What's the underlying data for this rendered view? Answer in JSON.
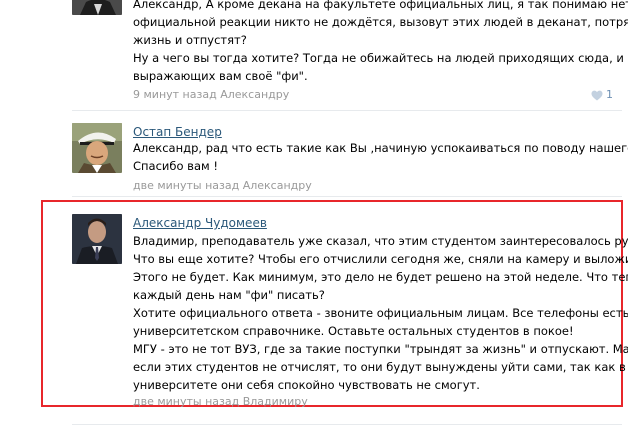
{
  "comments": [
    {
      "text_lines": [
        "Александр, А кроме декана на факультете официальных лиц, я так понимаю нет? И",
        "официальной реакции никто не дождётся, вызовут этих людей в деканат, потряднят за",
        "жизнь и отпустят?",
        "Ну а чего вы тогда хотите? Тогда не обижайтесь на людей приходящих сюда, и",
        "выражающих вам своё \"фи\"."
      ],
      "time": "9 минут назад",
      "reply_to": "Александру",
      "like_count": "1",
      "like_icon": "heart-icon"
    },
    {
      "author": "Остап Бендер",
      "text_lines": [
        "Александр, рад что есть такие как Вы ,начиную успокаиваться по поводу нашего будущего !",
        "Спасибо вам !"
      ],
      "time": "две минуты назад",
      "reply_to": "Александру"
    },
    {
      "author": "Александр Чудомеев",
      "text_lines": [
        "Владимир, преподаватель уже сказал, что этим студентом заинтересовалось руководство.",
        "Что вы еще хотите? Чтобы его отчислили сегодня же, сняли на камеру и выложили в сеть?",
        "Этого не будет. Как минимум, это дело не будет решено на этой неделе. Что теперь, будете",
        "каждый день нам \"фи\" писать?",
        "Хотите официального ответа - звоните официальным лицам. Все телефоны есть в",
        "университетском справочнике. Оставьте остальных студентов в покое!",
        "МГУ - это не тот ВУЗ, где за такие поступки \"трындят за жизнь\" и отпускают. Мало того,",
        "если этих студентов не отчислят, то они будут вынуждены уйти сами, так как в",
        "университете они себя спокойно чувствовать не смогут."
      ],
      "time": "две минуты назад",
      "reply_to": "Владимиру"
    }
  ],
  "colors": {
    "link": "#2b587a",
    "meta": "#999999",
    "highlight_border": "#e8262b",
    "divider": "#e7eaed"
  }
}
